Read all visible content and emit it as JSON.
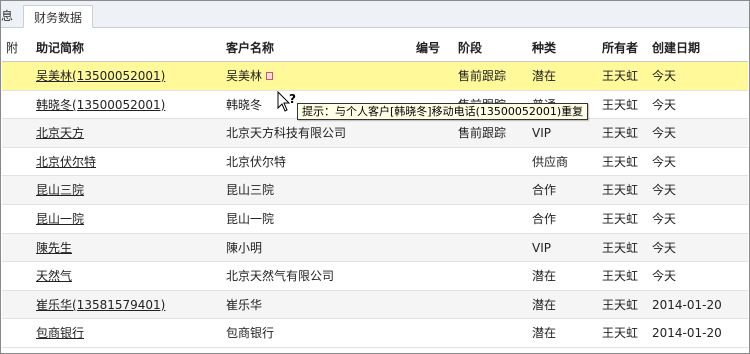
{
  "tabs": {
    "left_partial": "息",
    "active": "财务数据"
  },
  "columns": [
    "附",
    "助记简称",
    "客户名称",
    "编号",
    "阶段",
    "种类",
    "所有者",
    "创建日期"
  ],
  "rows": [
    {
      "short": "吴美林(13500052001)",
      "name": "吴美林",
      "code": "",
      "stage": "售前跟踪",
      "type": "潜在",
      "owner": "王天虹",
      "date": "今天"
    },
    {
      "short": "韩晓冬(13500052001)",
      "name": "韩晓冬",
      "code": "",
      "stage": "售前跟踪",
      "type": "普通",
      "owner": "王天虹",
      "date": "今天"
    },
    {
      "short": "北京天方",
      "name": "北京天方科技有限公司",
      "code": "",
      "stage": "售前跟踪",
      "type": "VIP",
      "owner": "王天虹",
      "date": "今天"
    },
    {
      "short": "北京伏尔特",
      "name": "北京伏尔特",
      "code": "",
      "stage": "",
      "type": "供应商",
      "owner": "王天虹",
      "date": "今天"
    },
    {
      "short": "昆山三院",
      "name": "昆山三院",
      "code": "",
      "stage": "",
      "type": "合作",
      "owner": "王天虹",
      "date": "今天"
    },
    {
      "short": "昆山一院",
      "name": "昆山一院",
      "code": "",
      "stage": "",
      "type": "合作",
      "owner": "王天虹",
      "date": "今天"
    },
    {
      "short": "陳先生",
      "name": "陳小明",
      "code": "",
      "stage": "",
      "type": "VIP",
      "owner": "王天虹",
      "date": "今天"
    },
    {
      "short": "天然气",
      "name": "北京天然气有限公司",
      "code": "",
      "stage": "",
      "type": "潜在",
      "owner": "王天虹",
      "date": "今天"
    },
    {
      "short": "崔乐华(13581579401)",
      "name": "崔乐华",
      "code": "",
      "stage": "",
      "type": "潜在",
      "owner": "王天虹",
      "date": "2014-01-20"
    },
    {
      "short": "包商银行",
      "name": "包商银行",
      "code": "",
      "stage": "",
      "type": "潜在",
      "owner": "王天虹",
      "date": "2014-01-20"
    }
  ],
  "tooltip": "提示：与个人客户[韩晓冬]移动电话(13500052001)重复",
  "colors": {
    "highlight": "#fff99a",
    "tooltip_bg": "#ffffe6"
  }
}
